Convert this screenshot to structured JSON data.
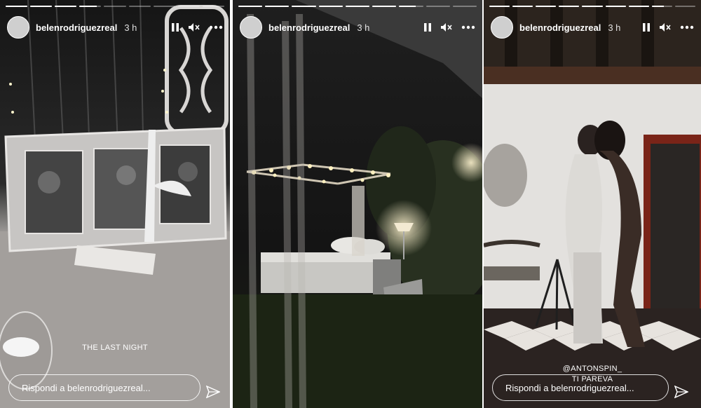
{
  "stories": [
    {
      "username": "belenrodriguezreal",
      "time": "3 h",
      "caption": "THE LAST NIGHT",
      "reply_placeholder": "Rispondi a belenrodriguezreal...",
      "progress": [
        1,
        1,
        1,
        0.8,
        0,
        0,
        0,
        0,
        0
      ]
    },
    {
      "username": "belenrodriguezreal",
      "time": "3 h",
      "reply_placeholder": "",
      "progress": [
        1,
        1,
        1,
        1,
        1,
        1,
        0.7,
        0,
        0
      ]
    },
    {
      "username": "belenrodriguezreal",
      "time": "3 h",
      "mention": "@ANTONSPIN_",
      "caption": "TI PAREVA",
      "reply_placeholder": "Rispondi a belenrodriguezreal...",
      "progress": [
        1,
        1,
        1,
        1,
        1,
        1,
        1,
        0.6,
        0
      ]
    }
  ],
  "icons": [
    "pause-icon",
    "mute-icon",
    "more-icon",
    "send-icon"
  ],
  "colors": {
    "ui_text": "#ffffff"
  }
}
